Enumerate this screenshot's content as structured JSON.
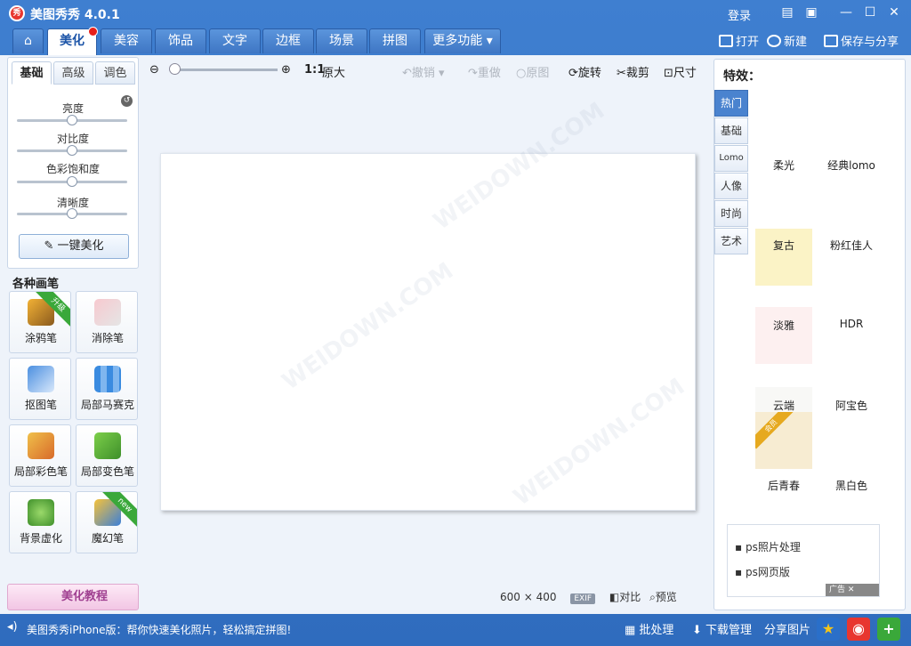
{
  "app": {
    "title": "美图秀秀 4.0.1",
    "logo_text": "秀",
    "login": "登录"
  },
  "window_controls": {
    "feedback": "feedback-icon",
    "skin": "skin-icon",
    "minimize": "—",
    "maximize": "☐",
    "close": "✕"
  },
  "nav": {
    "tabs": [
      "美化",
      "美容",
      "饰品",
      "文字",
      "边框",
      "场景",
      "拼图",
      "更多功能"
    ],
    "active": "美化"
  },
  "top_actions": {
    "open": "打开",
    "new": "新建",
    "save": "保存与分享"
  },
  "left": {
    "tabs": [
      "基础",
      "高级",
      "调色"
    ],
    "sliders": [
      {
        "label": "亮度",
        "value": 0.5
      },
      {
        "label": "对比度",
        "value": 0.5
      },
      {
        "label": "色彩饱和度",
        "value": 0.5
      },
      {
        "label": "清晰度",
        "value": 0.5
      }
    ],
    "one_key": "一键美化",
    "brush_title": "各种画笔",
    "brushes": [
      {
        "label": "涂鸦笔",
        "ribbon": "升级"
      },
      {
        "label": "消除笔",
        "ribbon": ""
      },
      {
        "label": "抠图笔",
        "ribbon": ""
      },
      {
        "label": "局部马赛克",
        "ribbon": ""
      },
      {
        "label": "局部彩色笔",
        "ribbon": ""
      },
      {
        "label": "局部变色笔",
        "ribbon": ""
      },
      {
        "label": "背景虚化",
        "ribbon": ""
      },
      {
        "label": "魔幻笔",
        "ribbon": "new"
      }
    ],
    "tutorial": "美化教程"
  },
  "toolbar": {
    "ratio": "1:1",
    "original_size": "原大",
    "undo": "撤销",
    "redo": "重做",
    "original": "原图",
    "rotate": "旋转",
    "crop": "裁剪",
    "size": "尺寸"
  },
  "canvas": {
    "width": "600",
    "height": "400",
    "times": "×",
    "exif": "EXIF",
    "compare": "对比",
    "preview": "预览"
  },
  "right": {
    "title": "特效：",
    "categories": [
      "热门",
      "基础",
      "Lomo",
      "人像",
      "时尚",
      "艺术"
    ],
    "effects": [
      "柔光",
      "经典lomo",
      "复古",
      "粉红佳人",
      "淡雅",
      "HDR",
      "云端",
      "阿宝色",
      "后青春",
      "黑白色"
    ],
    "badge": "会员",
    "ad_items": [
      "ps照片处理",
      "ps网页版"
    ],
    "ad_label": "广告"
  },
  "status": {
    "message": "美图秀秀iPhone版：帮你快速美化照片，轻松搞定拼图!",
    "batch": "批处理",
    "download": "下载管理",
    "share": "分享图片"
  },
  "colors": {
    "accent": "#2f6cbe",
    "red": "#e8201a",
    "green": "#3aa83a"
  }
}
